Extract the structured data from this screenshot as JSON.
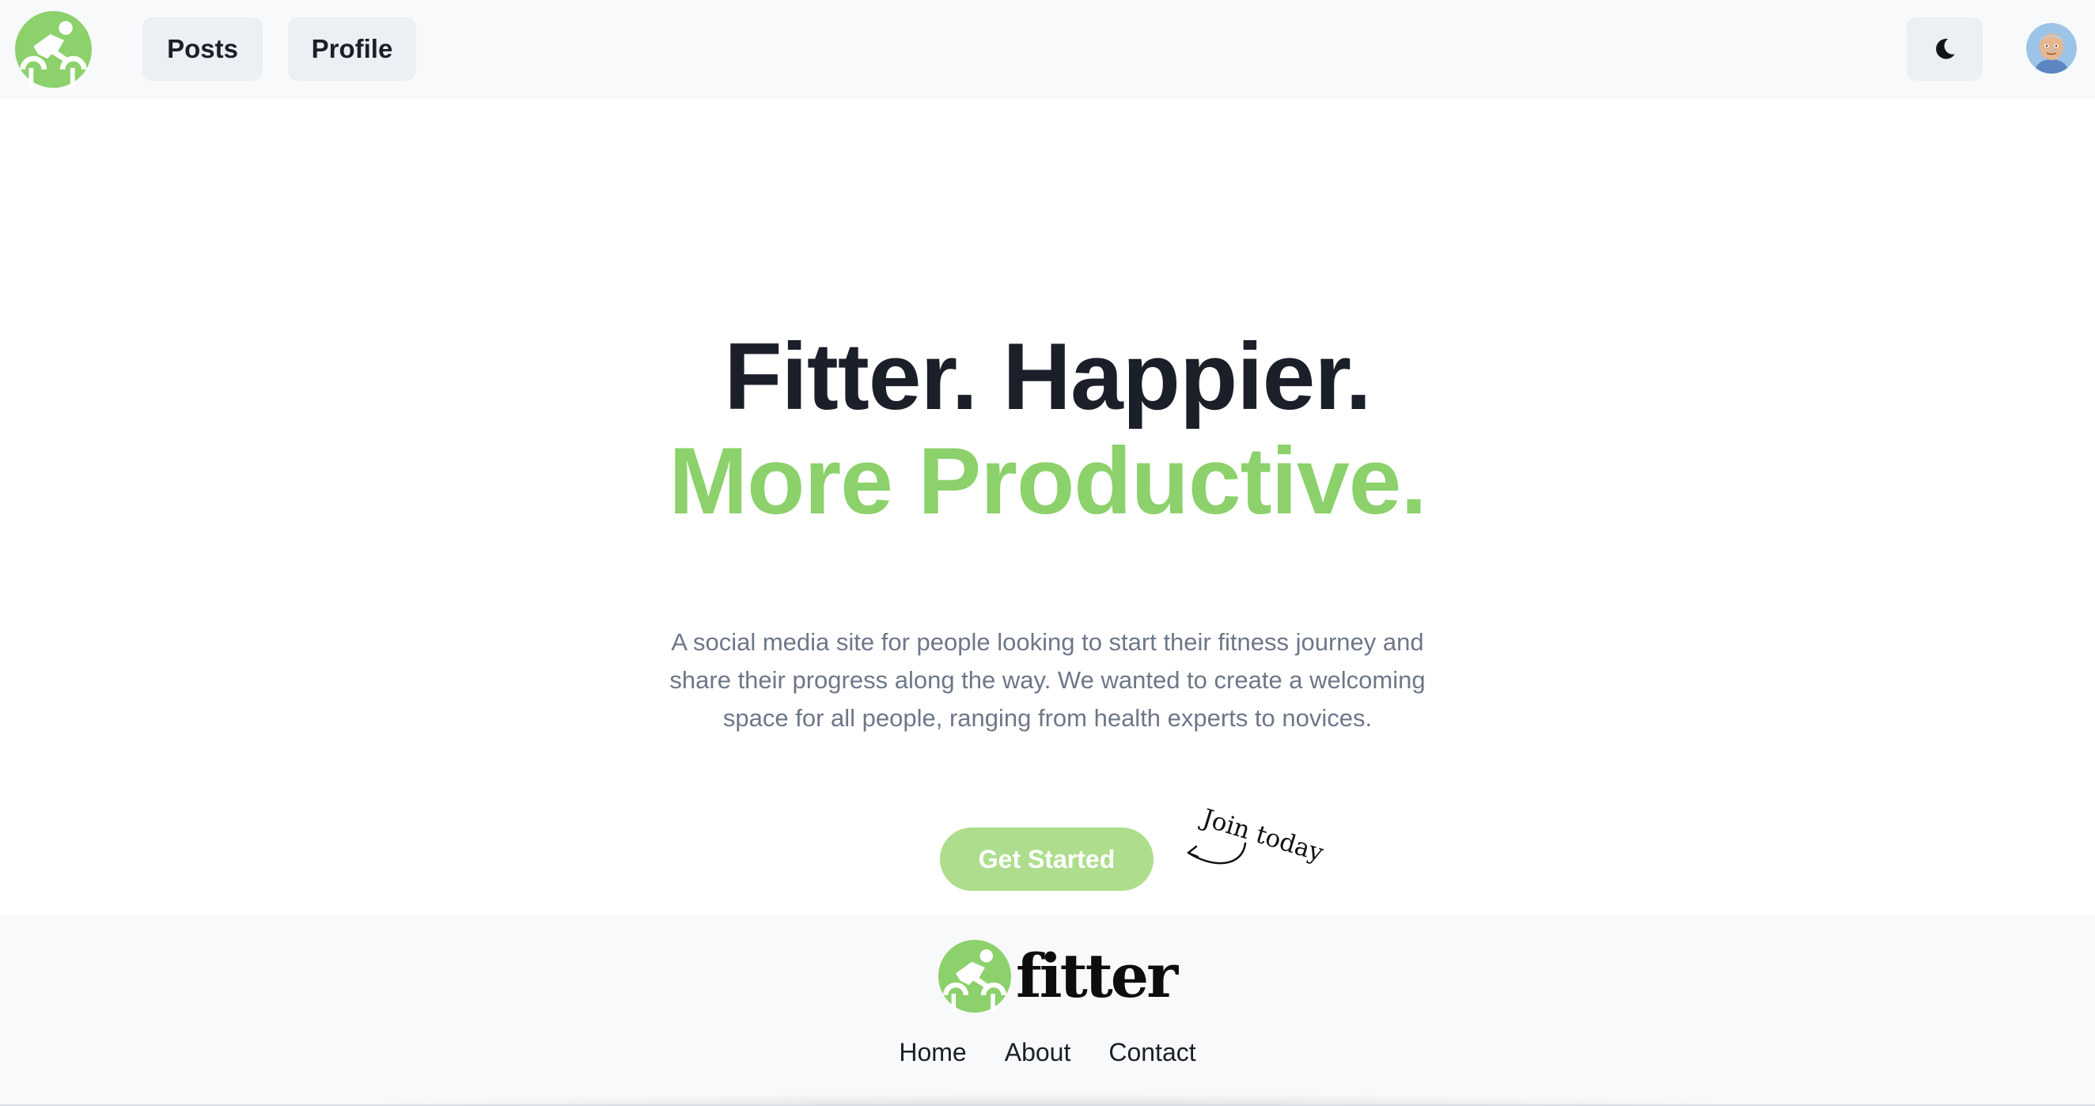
{
  "header": {
    "logo_icon": "cyclist-logo-icon",
    "nav": [
      {
        "label": "Posts"
      },
      {
        "label": "Profile"
      }
    ],
    "theme_toggle_icon": "moon-icon",
    "avatar_icon": "user-avatar"
  },
  "hero": {
    "title_line1": "Fitter. Happier.",
    "title_line2": "More Productive.",
    "description": "A social media site for people looking to start their fitness journey and share their progress along the way. We wanted to create a welcoming space for all people, ranging from health experts to novices.",
    "cta_label": "Get Started",
    "annotation": "Join today"
  },
  "footer": {
    "brand": "fitter",
    "links": [
      {
        "label": "Home"
      },
      {
        "label": "About"
      },
      {
        "label": "Contact"
      }
    ]
  },
  "colors": {
    "brand_green": "#8cd16b",
    "button_green": "#aede8d",
    "dark_text": "#1b1f2a",
    "muted_text": "#6e7789",
    "bar_bg": "#f8f9fb"
  }
}
